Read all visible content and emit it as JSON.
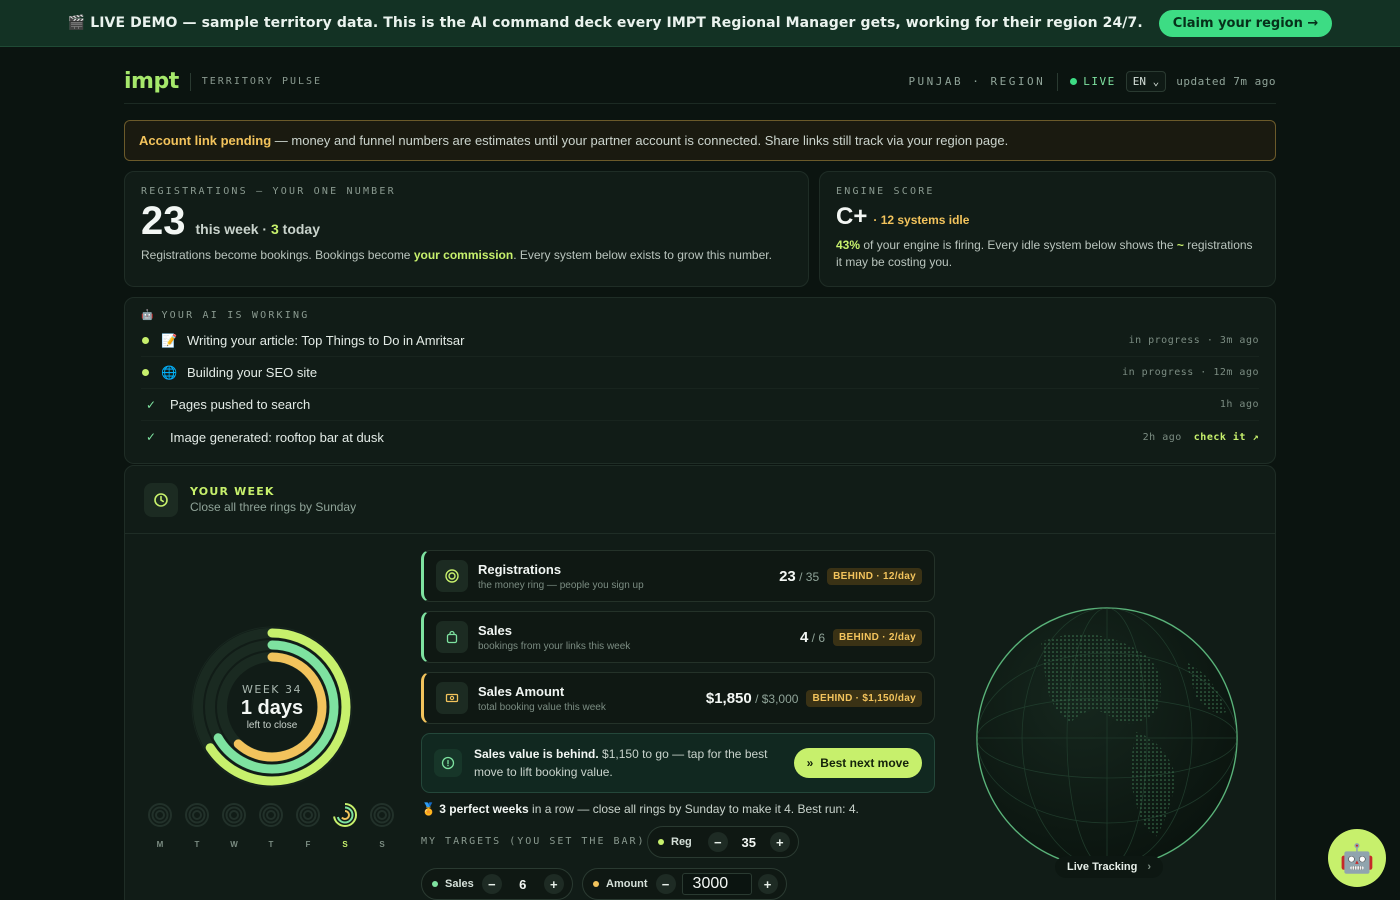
{
  "banner": {
    "text": "🎬 LIVE DEMO — sample territory data. This is the AI command deck every IMPT Regional Manager gets, working for their region 24/7.",
    "cta": "Claim your region →"
  },
  "header": {
    "logo": "impt",
    "product": "TERRITORY PULSE",
    "region": "PUNJAB · REGION",
    "live": "LIVE",
    "lang": "EN",
    "updated": "updated 7m ago"
  },
  "notice": {
    "title": "Account link pending",
    "text": " — money and funnel numbers are estimates until your partner account is connected. Share links still track via your region page."
  },
  "registrations": {
    "eyebrow": "REGISTRATIONS — YOUR ONE NUMBER",
    "number": "23",
    "week_label": "this week · ",
    "today_num": "3",
    "today_label": " today",
    "desc_a": "Registrations become bookings. Bookings become ",
    "desc_hl": "your commission",
    "desc_b": ". Every system below exists to grow this number."
  },
  "engine": {
    "eyebrow": "ENGINE SCORE",
    "grade": "C+",
    "idle": "· 12 systems idle",
    "pct": "43%",
    "desc_a": " of your engine is firing. Every idle system below shows the ",
    "desc_hl": "~",
    "desc_b": " registrations it may be costing you."
  },
  "ai": {
    "eyebrow": "YOUR AI IS WORKING",
    "tasks": [
      {
        "icon": "📝",
        "label": "Writing your article: Top Things to Do in Amritsar",
        "meta": "in progress · 3m ago"
      },
      {
        "icon": "🌐",
        "label": "Building your SEO site",
        "meta": "in progress · 12m ago"
      },
      {
        "icon": "✓",
        "label": "Pages pushed to search",
        "meta": "1h ago"
      },
      {
        "icon": "✓",
        "label": "Image generated: rooftop bar at dusk",
        "meta": "2h ago",
        "link": "check it ↗"
      }
    ]
  },
  "week": {
    "title": "YOUR WEEK",
    "subtitle": "Close all three rings by Sunday",
    "ring_week": "WEEK 34",
    "ring_days": "1 days",
    "ring_left": "left to close",
    "days": [
      "M",
      "T",
      "W",
      "T",
      "F",
      "S",
      "S"
    ],
    "active_day_index": 5,
    "metrics": [
      {
        "title": "Registrations",
        "sub": "the money ring — people you sign up",
        "value": "23",
        "target": " / 35",
        "badge": "BEHIND · 12/day",
        "progress": 0.657
      },
      {
        "title": "Sales",
        "sub": "bookings from your links this week",
        "value": "4",
        "target": " / 6",
        "badge": "BEHIND · 2/day",
        "progress": 0.667
      },
      {
        "title": "Sales Amount",
        "sub": "total booking value this week",
        "value": "$1,850",
        "target": " / $3,000",
        "badge": "BEHIND · $1,150/day",
        "progress": 0.617
      }
    ],
    "advice": {
      "bold": "Sales value is behind.",
      "text": " $1,150 to go — tap for the best move to lift booking value.",
      "button": "Best next move"
    },
    "streak": {
      "icon": "🏅",
      "bold": "3 perfect weeks",
      "text": " in a row — close all rings by Sunday to make it 4. Best run: 4."
    },
    "targets": {
      "label": "MY TARGETS (YOU SET THE BAR):",
      "reg_label": "Reg",
      "reg_value": "35",
      "sales_label": "Sales",
      "sales_value": "6",
      "amount_label": "Amount",
      "amount_value": "3000"
    },
    "live_tracking": "Live Tracking"
  },
  "colors": {
    "accent": "#c7f06c",
    "green": "#7ee2a0",
    "amber": "#f2c35c",
    "bg": "#0b1410"
  }
}
